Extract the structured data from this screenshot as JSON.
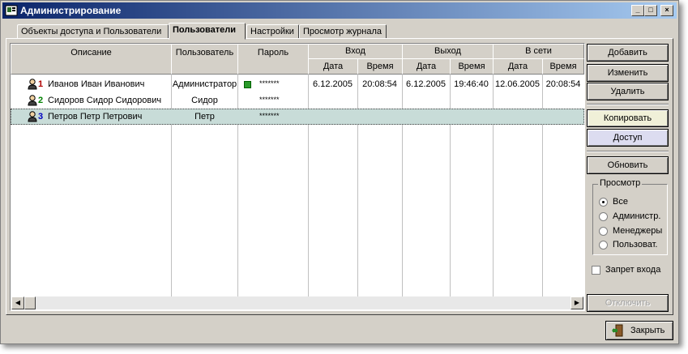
{
  "window": {
    "title": "Администрирование",
    "btn_min": "_",
    "btn_max": "□",
    "btn_close": "×"
  },
  "tabs": [
    {
      "label": "Объекты доступа и Пользователи"
    },
    {
      "label": "Пользователи"
    },
    {
      "label": "Настройки"
    },
    {
      "label": "Просмотр журнала"
    }
  ],
  "grid": {
    "headers": {
      "desc": "Описание",
      "user": "Пользователь",
      "pass": "Пароль",
      "in": "Вход",
      "out": "Выход",
      "online": "В сети",
      "date": "Дата",
      "time": "Время"
    },
    "rows": [
      {
        "num": "1",
        "desc": "Иванов Иван Иванович",
        "user": "Администратор",
        "pass": "*******",
        "in_date": "6.12.2005",
        "in_time": "20:08:54",
        "out_date": "6.12.2005",
        "out_time": "19:46:40",
        "on_date": "12.06.2005",
        "on_time": "20:08:54"
      },
      {
        "num": "2",
        "desc": "Сидоров Сидор Сидорович",
        "user": "Сидор",
        "pass": "*******",
        "in_date": "",
        "in_time": "",
        "out_date": "",
        "out_time": "",
        "on_date": "",
        "on_time": ""
      },
      {
        "num": "3",
        "desc": "Петров Петр Петрович",
        "user": "Петр",
        "pass": "*******",
        "in_date": "",
        "in_time": "",
        "out_date": "",
        "out_time": "",
        "on_date": "",
        "on_time": ""
      }
    ]
  },
  "buttons": {
    "add": "Добавить",
    "edit": "Изменить",
    "delete": "Удалить",
    "copy": "Копировать",
    "access": "Доступ",
    "refresh": "Обновить",
    "disconnect": "Отключить",
    "close": "Закрыть"
  },
  "view": {
    "title": "Просмотр",
    "options": [
      "Все",
      "Администр.",
      "Менеджеры",
      "Пользоват."
    ],
    "selected": 0
  },
  "deny_login": "Запрет входа",
  "colors": {
    "status_online": "#2a9a2a",
    "selected_row": "#c8dcd8",
    "title_start": "#0a246a"
  }
}
